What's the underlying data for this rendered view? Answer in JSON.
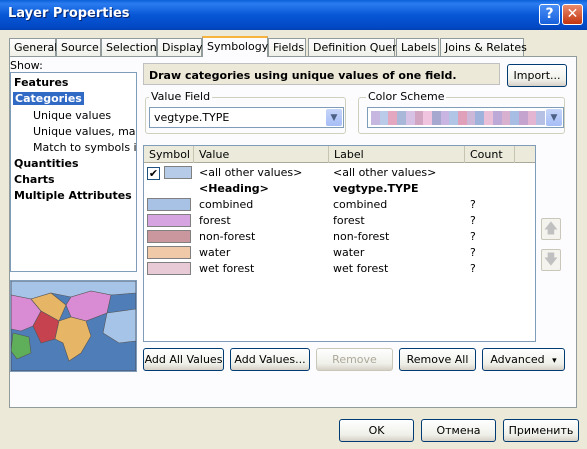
{
  "window": {
    "title": "Layer Properties",
    "help_glyph": "?",
    "close_glyph": "✕"
  },
  "tabs": [
    {
      "label": "General"
    },
    {
      "label": "Source"
    },
    {
      "label": "Selection"
    },
    {
      "label": "Display"
    },
    {
      "label": "Symbology"
    },
    {
      "label": "Fields"
    },
    {
      "label": "Definition Query"
    },
    {
      "label": "Labels"
    },
    {
      "label": "Joins & Relates"
    }
  ],
  "active_tab": "Symbology",
  "show": {
    "label": "Show:",
    "items": [
      {
        "label": "Features"
      },
      {
        "label": "Categories"
      },
      {
        "label": "Unique values"
      },
      {
        "label": "Unique values, many fields"
      },
      {
        "label": "Match to symbols in a style"
      },
      {
        "label": "Quantities"
      },
      {
        "label": "Charts"
      },
      {
        "label": "Multiple Attributes"
      }
    ]
  },
  "description": "Draw categories using unique values of one field.",
  "import_button": "Import...",
  "value_field": {
    "label": "Value Field",
    "value": "vegtype.TYPE"
  },
  "color_scheme": {
    "label": "Color Scheme",
    "colors": [
      "#c6b7e0",
      "#b9cbe8",
      "#e3a8c0",
      "#a9b7d9",
      "#d7c2e6",
      "#d2a6c2",
      "#f0c4de",
      "#a6a8cf",
      "#c9b5e2",
      "#b1c6e6",
      "#e1a0ba",
      "#cdb7d9",
      "#9fb2dc",
      "#e9c0d7",
      "#bca9d8",
      "#d8b0d0",
      "#a8bde3",
      "#c4a4cf",
      "#e4b5d3",
      "#b5c0e4"
    ]
  },
  "grid": {
    "columns": [
      {
        "label": "Symbol"
      },
      {
        "label": "Value"
      },
      {
        "label": "Label"
      },
      {
        "label": "Count"
      }
    ],
    "rows": [
      {
        "checked": true,
        "color": "#b5cbe8",
        "value": "<all other values>",
        "label": "<all other values>",
        "count": "",
        "bold": false
      },
      {
        "color": "",
        "value": "<Heading>",
        "label": "vegtype.TYPE",
        "count": "",
        "bold": true
      },
      {
        "color": "#a7c2e5",
        "value": "combined",
        "label": "combined",
        "count": "?",
        "bold": false
      },
      {
        "color": "#d6a4e0",
        "value": "forest",
        "label": "forest",
        "count": "?",
        "bold": false
      },
      {
        "color": "#c9979d",
        "value": "non-forest",
        "label": "non-forest",
        "count": "?",
        "bold": false
      },
      {
        "color": "#f0caa8",
        "value": "water",
        "label": "water",
        "count": "?",
        "bold": false
      },
      {
        "color": "#e8c9d6",
        "value": "wet forest",
        "label": "wet forest",
        "count": "?",
        "bold": false
      }
    ]
  },
  "side_arrows": {
    "up": "🡅",
    "down": "🡇"
  },
  "actions": {
    "add_all": "Add All Values",
    "add_values": "Add Values...",
    "remove": "Remove",
    "remove_all": "Remove All",
    "advanced": "Advanced",
    "advanced_arrow": "▾"
  },
  "footer": {
    "ok": "OK",
    "cancel": "Отмена",
    "apply": "Применить"
  },
  "preview_colors": {
    "land1": "#d98bd4",
    "land2": "#e7b566",
    "land3": "#a6c3e8",
    "land4": "#c6424e",
    "land5": "#5fae5a",
    "water": "#4f7db8"
  }
}
